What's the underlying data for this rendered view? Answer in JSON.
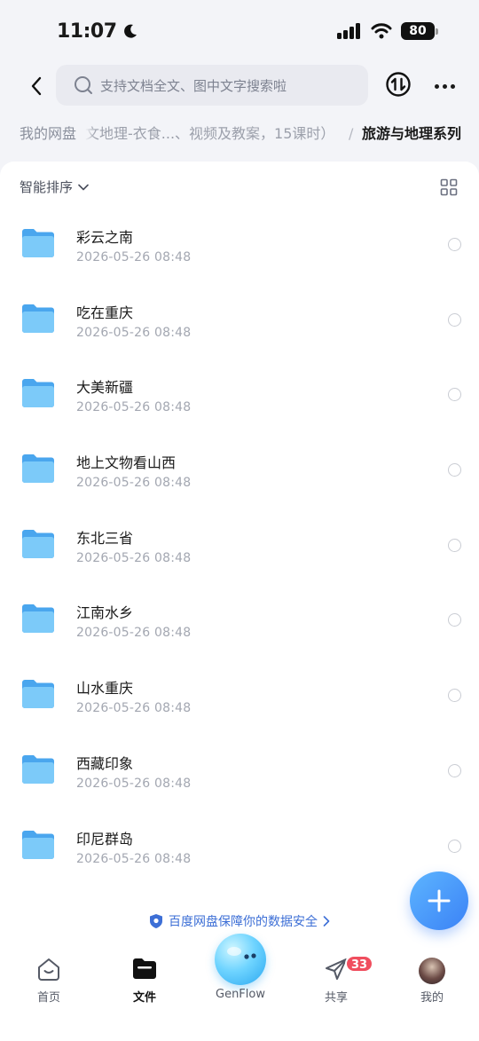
{
  "status_bar": {
    "time": "11:07",
    "battery": "80"
  },
  "search": {
    "placeholder": "支持文档全文、图中文字搜索啦"
  },
  "breadcrumb": {
    "root": "我的网盘",
    "middle": "文地理-衣食...、视频及教案，15课时）",
    "separator": "/",
    "current": "旅游与地理系列"
  },
  "toolbar": {
    "sort_label": "智能排序"
  },
  "files": [
    {
      "name": "彩云之南",
      "date": "2026-05-26 08:48"
    },
    {
      "name": "吃在重庆",
      "date": "2026-05-26 08:48"
    },
    {
      "name": "大美新疆",
      "date": "2026-05-26 08:48"
    },
    {
      "name": "地上文物看山西",
      "date": "2026-05-26 08:48"
    },
    {
      "name": "东北三省",
      "date": "2026-05-26 08:48"
    },
    {
      "name": "江南水乡",
      "date": "2026-05-26 08:48"
    },
    {
      "name": "山水重庆",
      "date": "2026-05-26 08:48"
    },
    {
      "name": "西藏印象",
      "date": "2026-05-26 08:48"
    },
    {
      "name": "印尼群岛",
      "date": "2026-05-26 08:48"
    }
  ],
  "security_note": "百度网盘保障你的数据安全",
  "tabs": {
    "home": "首页",
    "files": "文件",
    "genflow": "GenFlow",
    "share": "共享",
    "mine": "我的",
    "share_badge": "33"
  },
  "colors": {
    "accent": "#3b82f6",
    "folder": "#5bb4f5",
    "badge": "#f04e5e",
    "security_text": "#3d6fd6"
  },
  "icons": {
    "back": "chevron-left-icon",
    "search": "search-icon",
    "transfer": "transfer-icon",
    "more": "more-icon",
    "grid": "grid-view-icon",
    "folder": "folder-icon",
    "shield": "shield-icon",
    "add": "plus-icon"
  }
}
